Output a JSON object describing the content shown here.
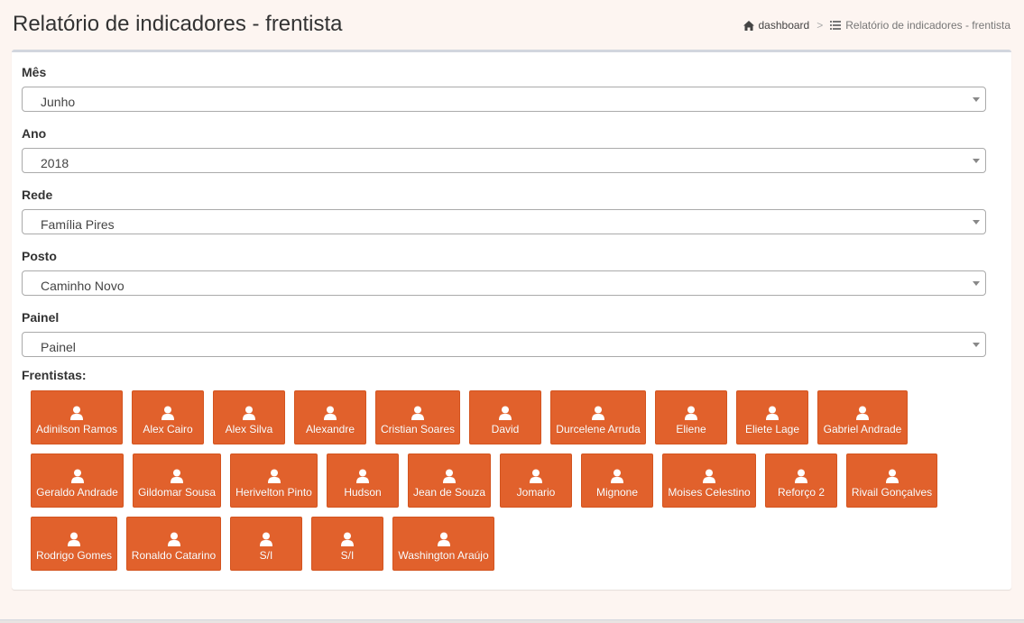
{
  "header": {
    "title": "Relatório de indicadores - frentista",
    "breadcrumb": {
      "home_label": "dashboard",
      "home_icon": "home-icon",
      "separator": ">",
      "current_label": "Relatório de indicadores - frentista",
      "current_icon": "list-icon"
    }
  },
  "form": {
    "mes": {
      "label": "Mês",
      "value": "Junho"
    },
    "ano": {
      "label": "Ano",
      "value": "2018"
    },
    "rede": {
      "label": "Rede",
      "value": "Família Pires"
    },
    "posto": {
      "label": "Posto",
      "value": "Caminho Novo"
    },
    "painel": {
      "label": "Painel",
      "value": "Painel"
    }
  },
  "frentistas": {
    "label": "Frentistas:",
    "icon": "user-icon",
    "button_color": "#e1612c",
    "names": [
      "Adinilson Ramos",
      "Alex Cairo",
      "Alex Silva",
      "Alexandre",
      "Cristian Soares",
      "David",
      "Durcelene Arruda",
      "Eliene",
      "Eliete Lage",
      "Gabriel Andrade",
      "Geraldo Andrade",
      "Gildomar Sousa",
      "Herivelton Pinto",
      "Hudson",
      "Jean de Souza",
      "Jomario",
      "Mignone",
      "Moises Celestino",
      "Reforço 2",
      "Rivail Gonçalves",
      "Rodrigo Gomes",
      "Ronaldo Catarino",
      "S/I",
      "S/I",
      "Washington Araújo"
    ]
  }
}
